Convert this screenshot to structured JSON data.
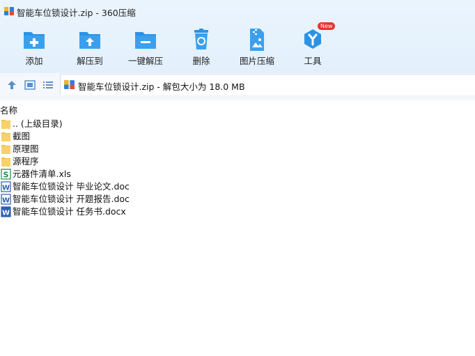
{
  "window": {
    "title": "智能车位锁设计.zip - 360压缩"
  },
  "toolbar": {
    "buttons": [
      {
        "label": "添加",
        "icon": "add-folder-icon"
      },
      {
        "label": "解压到",
        "icon": "extract-to-icon"
      },
      {
        "label": "一键解压",
        "icon": "one-click-extract-icon"
      },
      {
        "label": "删除",
        "icon": "recycle-bin-icon"
      },
      {
        "label": "图片压缩",
        "icon": "image-compress-icon"
      },
      {
        "label": "工具",
        "icon": "tools-icon",
        "badge": "New"
      }
    ]
  },
  "address": {
    "text": "智能车位锁设计.zip - 解包大小为 18.0 MB"
  },
  "list": {
    "column_name": "名称",
    "items": [
      {
        "name": ".. (上级目录)",
        "type": "folder"
      },
      {
        "name": "截图",
        "type": "folder"
      },
      {
        "name": "原理图",
        "type": "folder"
      },
      {
        "name": "源程序",
        "type": "folder"
      },
      {
        "name": "元器件清单.xls",
        "type": "excel"
      },
      {
        "name": "智能车位锁设计 毕业论文.doc",
        "type": "word"
      },
      {
        "name": "智能车位锁设计 开题报告.doc",
        "type": "word"
      },
      {
        "name": "智能车位锁设计 任务书.docx",
        "type": "word"
      }
    ]
  },
  "colors": {
    "accent": "#2b93e6",
    "toolbar_bg": "#e6f2fc",
    "folder": "#f7d26b",
    "excel": "#1f8a4c",
    "word": "#2b5fb8",
    "badge": "#e8322f"
  }
}
